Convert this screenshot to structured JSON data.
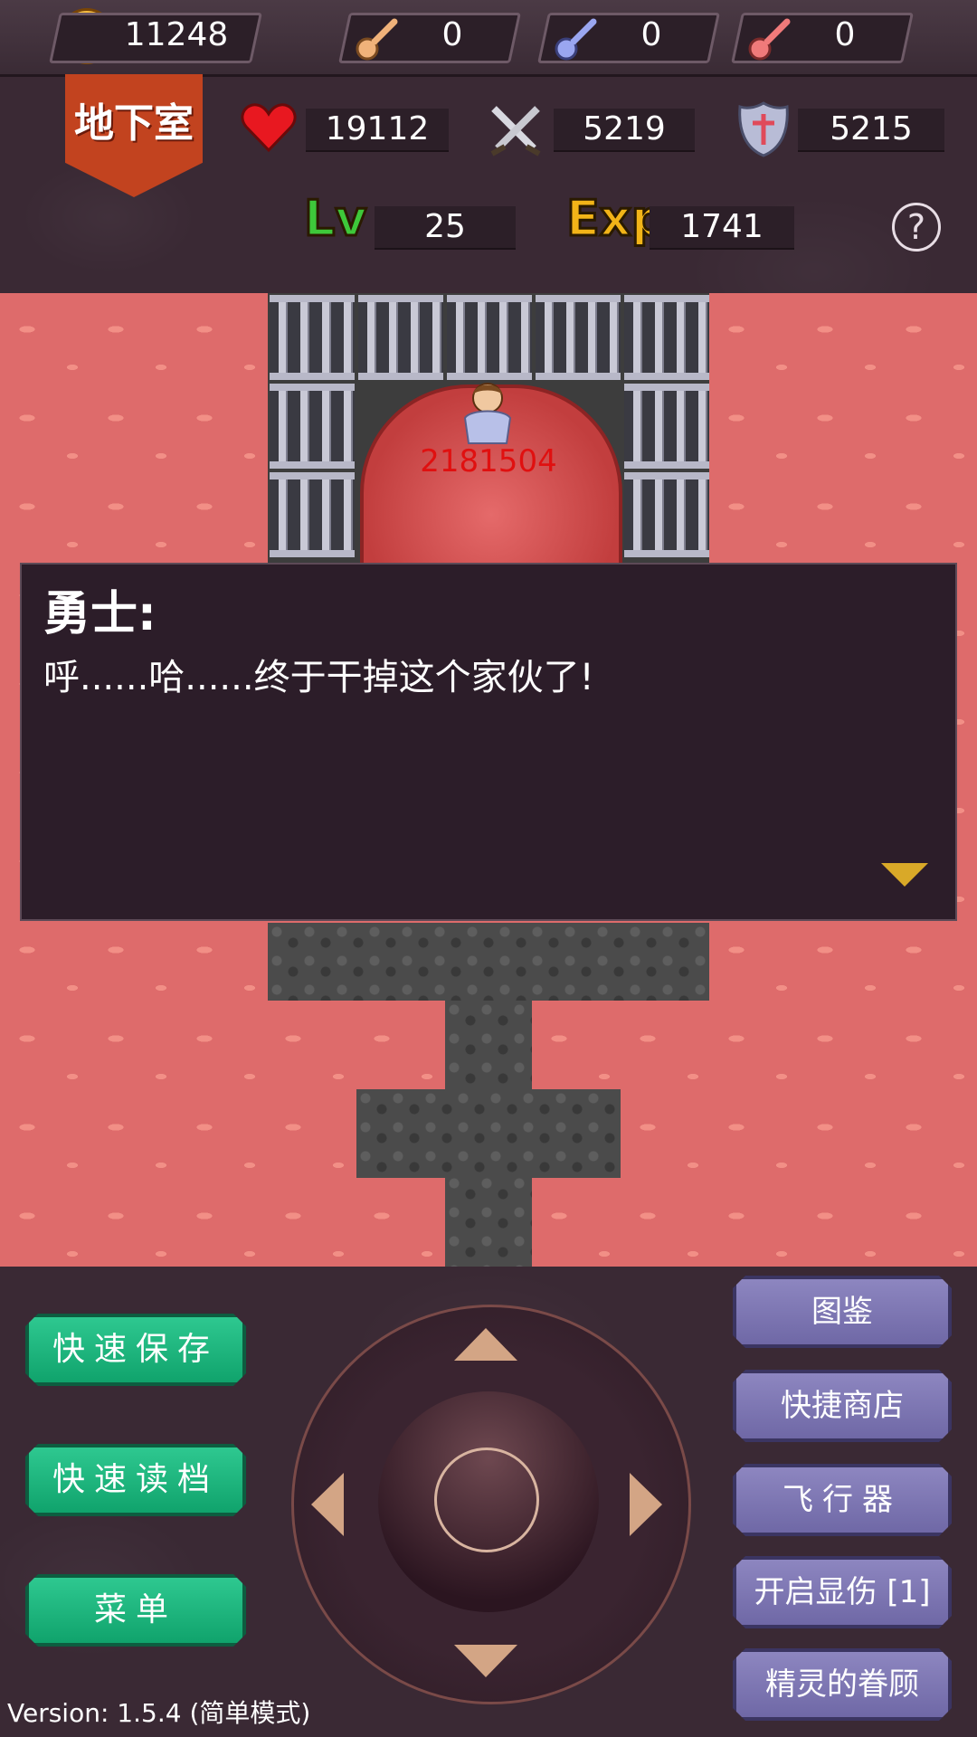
{
  "resources": {
    "gold": "11248",
    "yellow_keys": "0",
    "blue_keys": "0",
    "red_keys": "0"
  },
  "floor": {
    "name": "地下室"
  },
  "stats": {
    "hp": "19112",
    "attack": "5219",
    "defense": "5215",
    "level_label": "Lv",
    "level": "25",
    "exp_label": "Exp",
    "exp": "1741"
  },
  "help_icon": "?",
  "map": {
    "damage_value": "2181504"
  },
  "dialog": {
    "speaker": "勇士:",
    "text": "呼......哈......终于干掉这个家伙了!"
  },
  "left_buttons": {
    "quick_save": "快速保存",
    "quick_load": "快速读档",
    "menu": "菜单"
  },
  "right_buttons": {
    "encyclopedia": "图鉴",
    "quick_shop": "快捷商店",
    "fly": "飞行器",
    "show_damage": "开启显伤 [1]",
    "spirit_favor": "精灵的眷顾"
  },
  "version": "Version: 1.5.4 (简单模式)",
  "colors": {
    "lava": "#de6b6b",
    "green_button": "#10a36c",
    "purple_button": "#6f68a6",
    "dialog_bg": "#2c1d29",
    "damage_text": "#e01010"
  }
}
